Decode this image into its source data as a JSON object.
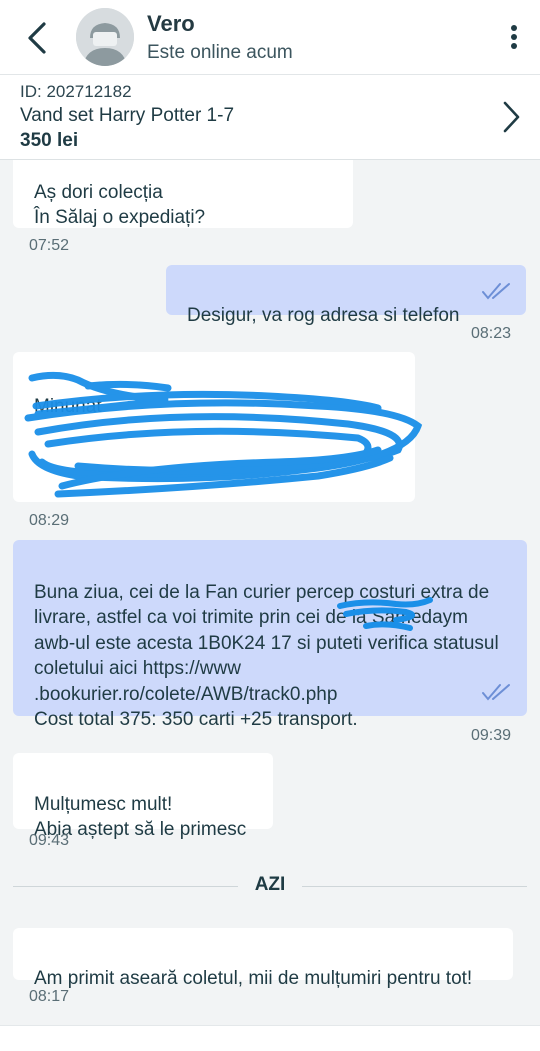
{
  "header": {
    "contact_name": "Vero",
    "status": "Este online acum",
    "back_icon": "chevron-left-icon",
    "more_icon": "vertical-dots-icon"
  },
  "ad": {
    "id_label": "ID: 202712182",
    "title": "Vand set Harry Potter 1-7",
    "price": "350 lei"
  },
  "messages": [
    {
      "direction": "in",
      "text": "Aș dori colecția\nÎn Sălaj o expediați?",
      "time": "07:52"
    },
    {
      "direction": "out",
      "text": "Desigur, va rog adresa si telefon",
      "time": "08:23",
      "read": true
    },
    {
      "direction": "in",
      "text": "Minunat",
      "time": "08:29",
      "redacted": true
    },
    {
      "direction": "out",
      "text": "Buna ziua, cei de la Fan curier percep costuri extra de livrare, astfel ca voi trimite prin cei de la Samedaym awb-ul este acesta 1B0K24 17 si puteti verifica statusul coletului aici https://www .bookurier.ro/colete/AWB/track0.php\nCost total 375: 350 carti +25 transport.",
      "time": "09:39",
      "read": true
    },
    {
      "direction": "in",
      "text": "Mulțumesc mult!\nAbia aștept să le primesc",
      "time": "09:43"
    },
    {
      "direction": "in",
      "text": "Am primit aseară coletul, mii de mulțumiri pentru tot!",
      "time": "08:17"
    }
  ],
  "divider": {
    "label": "AZI"
  },
  "colors": {
    "incoming_bubble": "#ffffff",
    "outgoing_bubble": "#cdd9fb",
    "read_ticks": "#6d8fd6",
    "redaction": "#1a8fe8"
  }
}
